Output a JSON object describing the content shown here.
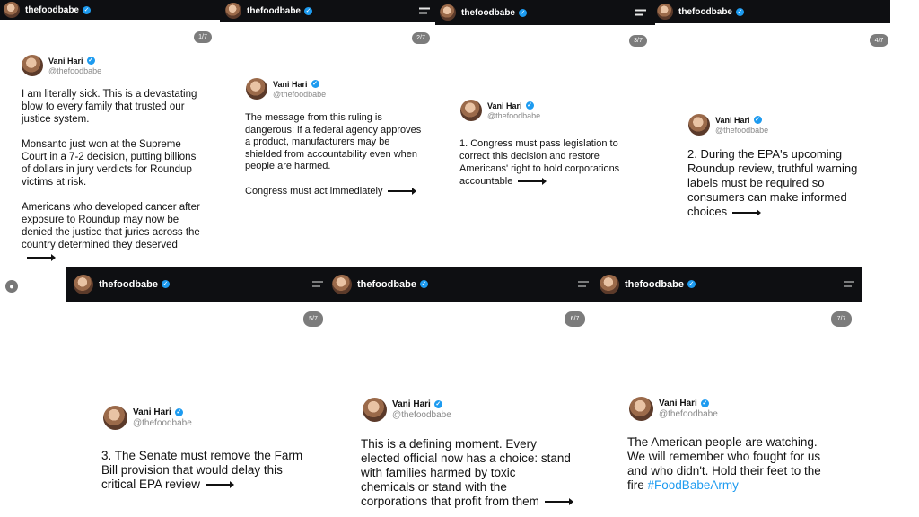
{
  "account": {
    "username": "thefoodbabe",
    "display_name": "Vani Hari",
    "handle": "@thefoodbabe"
  },
  "slides": [
    {
      "page": "1/7",
      "paragraphs": [
        "I am literally sick. This is a devastating blow to every family that trusted our justice system.",
        "Monsanto just won at the Supreme Court in a 7-2 decision, putting billions of dollars in jury verdicts for Roundup victims at risk.",
        "Americans who developed cancer after exposure to Roundup may now be denied the justice that juries across the country determined they deserved"
      ]
    },
    {
      "page": "2/7",
      "paragraphs": [
        "The message from this ruling is dangerous: if a federal agency approves a product, manufacturers may be shielded from accountability even when people are harmed.",
        "Congress must act immediately"
      ]
    },
    {
      "page": "3/7",
      "paragraphs": [
        "1. Congress must pass legislation to correct this decision and restore Americans' right to hold corporations accountable"
      ]
    },
    {
      "page": "4/7",
      "paragraphs": [
        "2. During the EPA's upcoming Roundup review, truthful warning labels must be required so consumers can make informed choices"
      ]
    },
    {
      "page": "5/7",
      "paragraphs": [
        "3. The Senate must remove the Farm Bill provision that would delay this critical EPA review"
      ]
    },
    {
      "page": "6/7",
      "paragraphs": [
        "This is a defining moment. Every elected official now has a choice: stand with families harmed by toxic chemicals or stand with the corporations that profit from them"
      ]
    },
    {
      "page": "7/7",
      "paragraphs": [
        "The American people are watching. We will remember who fought for us and who didn't. Hold their feet to the fire"
      ],
      "hashtag": "#FoodBabeArmy"
    }
  ],
  "icons": [
    "avatar",
    "verified-badge-icon",
    "menu-icon",
    "arrow-right-icon",
    "profile-icon"
  ],
  "colors": {
    "topbar": "#0e0f12",
    "verified": "#1d9bf0",
    "hashtag": "#1d9bf0",
    "pager": "#7c7c7c"
  }
}
